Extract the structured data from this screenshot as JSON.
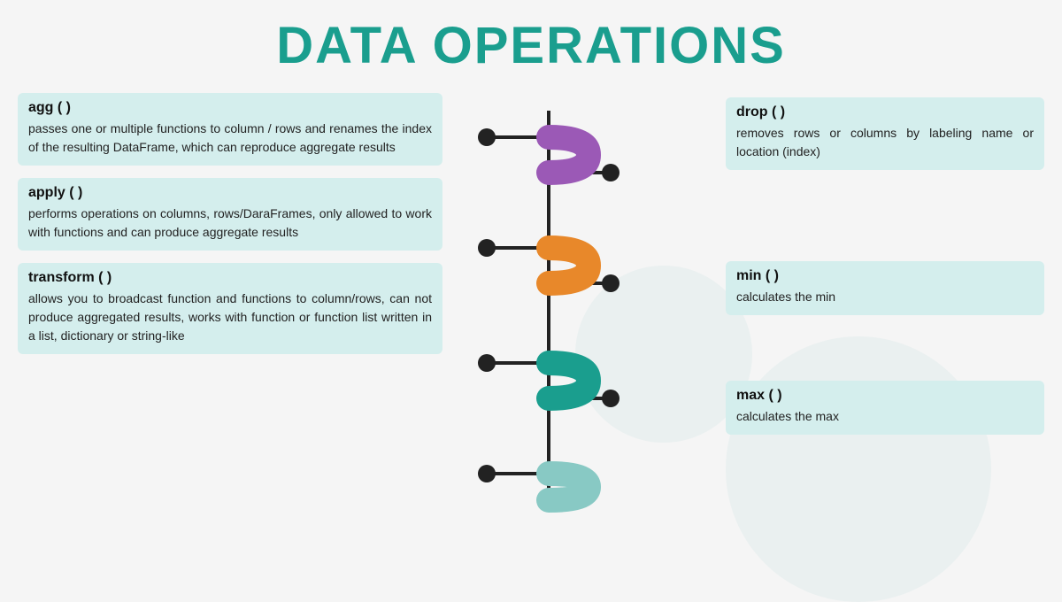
{
  "title": "DATA OPERATIONS",
  "colors": {
    "teal": "#1a9e8e",
    "card_bg": "#d4eeed",
    "purple": "#9b59b6",
    "orange": "#e8882a",
    "teal_accent": "#1a9e8e",
    "light_teal": "#88c9c4",
    "bg": "#f5f5f5"
  },
  "left_cards": [
    {
      "id": "agg",
      "title": "agg ( )",
      "body": "passes one or multiple functions to column / rows and renames the index of the resulting DataFrame, which can reproduce aggregate results"
    },
    {
      "id": "apply",
      "title": "apply ( )",
      "body": "performs operations on columns, rows/DaraFrames, only allowed to work with functions and can produce aggregate results"
    },
    {
      "id": "transform",
      "title": "transform ( )",
      "body": "allows you to broadcast function and functions to column/rows, can not produce aggregated results, works with function or function list written in a list, dictionary or string-like"
    }
  ],
  "right_cards": [
    {
      "id": "drop",
      "title": "drop ( )",
      "body": "removes rows or columns by labeling name or location (index)"
    },
    {
      "id": "min",
      "title": "min ( )",
      "body": "calculates the min"
    },
    {
      "id": "max",
      "title": "max ( )",
      "body": "calculates the max"
    }
  ]
}
